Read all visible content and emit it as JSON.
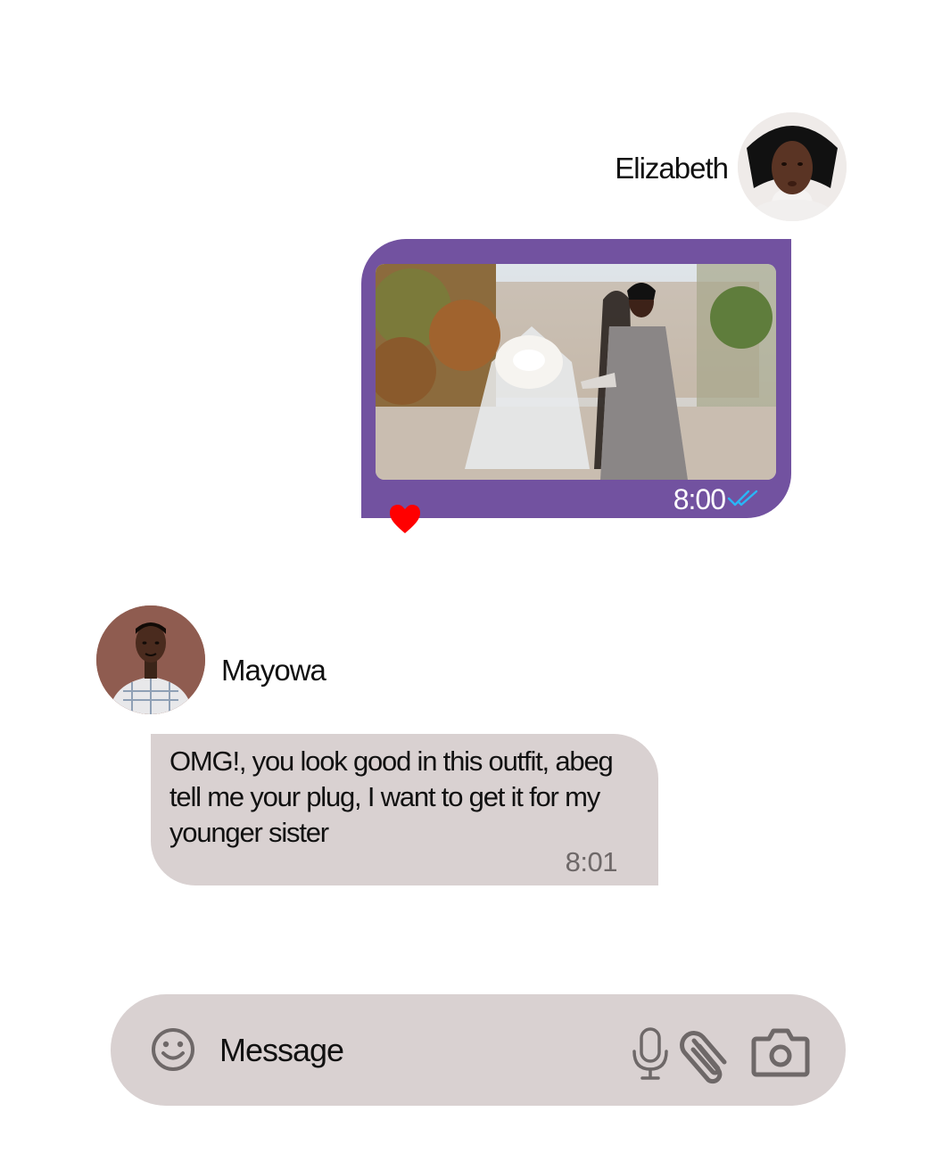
{
  "outgoing": {
    "sender_name": "Elizabeth",
    "avatar_icon": "elizabeth-avatar",
    "attachment": "photo",
    "time": "8:00",
    "status_icon": "double-check-icon",
    "reaction_icon": "heart-icon",
    "bubble_color": "#7252a0",
    "reaction_color": "#ff0000",
    "status_color": "#29b6f6"
  },
  "incoming": {
    "sender_name": "Mayowa",
    "avatar_icon": "mayowa-avatar",
    "text": "OMG!, you look good in this outfit, abeg tell me your plug, I want to get it for my younger sister",
    "time": "8:01",
    "bubble_color": "#d9d1d1"
  },
  "composer": {
    "placeholder": "Message",
    "icons": [
      "smiley-icon",
      "microphone-icon",
      "paperclip-icon",
      "camera-icon"
    ],
    "background_color": "#d9d1d1",
    "icon_color": "#6e6868"
  }
}
